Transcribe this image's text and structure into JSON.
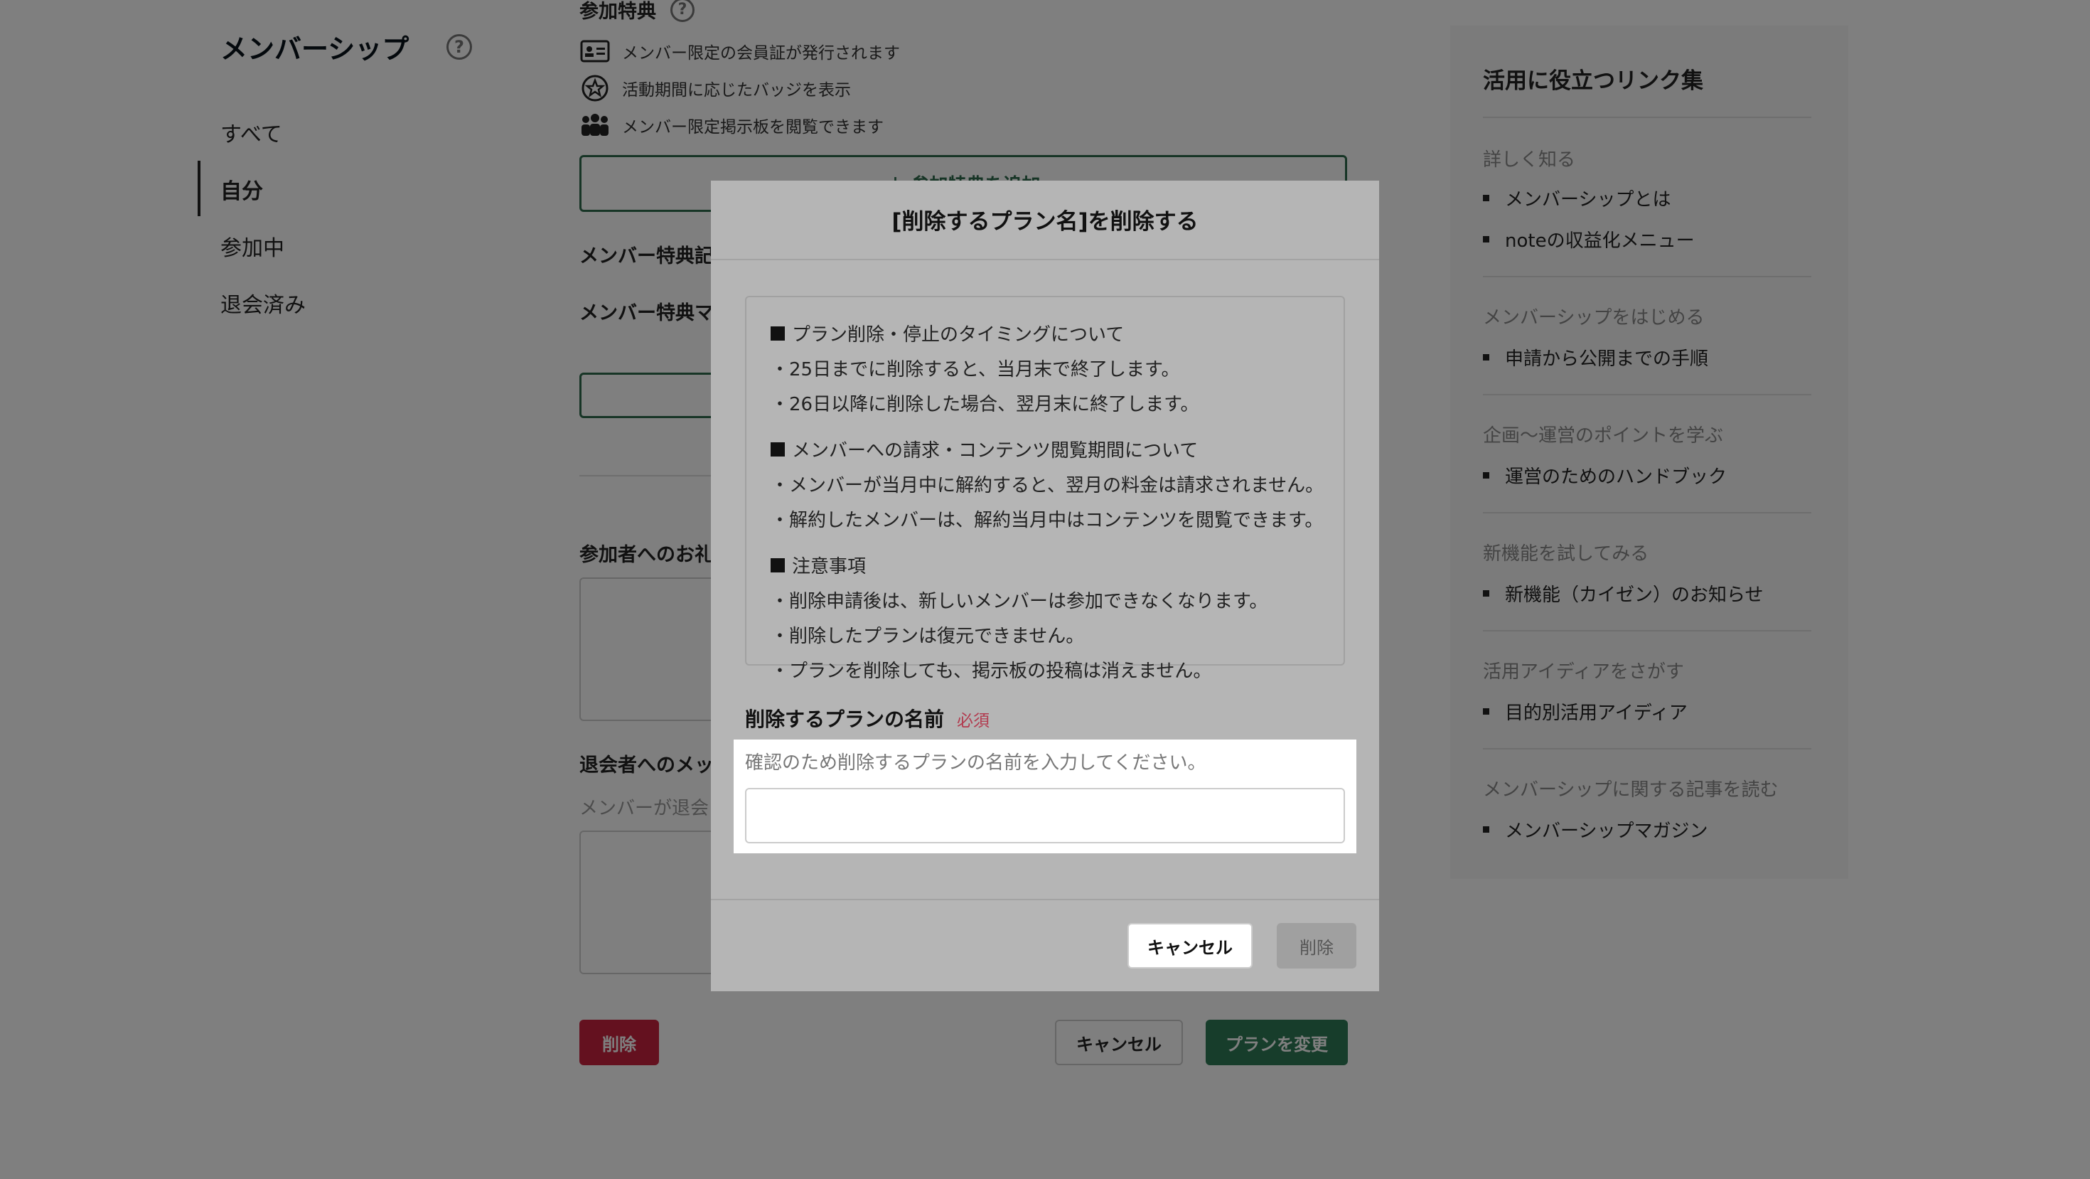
{
  "nav": {
    "title": "メンバーシップ",
    "items": [
      {
        "label": "すべて"
      },
      {
        "label": "自分"
      },
      {
        "label": "参加中"
      },
      {
        "label": "退会済み"
      }
    ]
  },
  "form": {
    "benefits_heading": "参加特典",
    "benefits": [
      {
        "icon": "id-card-icon",
        "label": "メンバー限定の会員証が発行されます"
      },
      {
        "icon": "badge-star-icon",
        "label": "活動期間に応じたバッジを表示"
      },
      {
        "icon": "people-icon",
        "label": "メンバー限定掲示板を閲覧できます"
      }
    ],
    "add_benefit_label": "＋ 参加特典を追加",
    "article_heading": "メンバー特典記",
    "magazine_heading": "メンバー特典マ",
    "thanks_heading": "参加者へのお礼",
    "leave_heading": "退会者へのメッ",
    "leave_sub": "メンバーが退会",
    "delete_label": "削除",
    "cancel_label": "キャンセル",
    "change_label": "プランを変更"
  },
  "sidebar": {
    "title": "活用に役立つリンク集",
    "sections": [
      {
        "heading": "詳しく知る",
        "links": [
          "メンバーシップとは",
          "noteの収益化メニュー"
        ]
      },
      {
        "heading": "メンバーシップをはじめる",
        "links": [
          "申請から公開までの手順"
        ]
      },
      {
        "heading": "企画〜運営のポイントを学ぶ",
        "links": [
          "運営のためのハンドブック"
        ]
      },
      {
        "heading": "新機能を試してみる",
        "links": [
          "新機能（カイゼン）のお知らせ"
        ]
      },
      {
        "heading": "活用アイディアをさがす",
        "links": [
          "目的別活用アイディア"
        ]
      },
      {
        "heading": "メンバーシップに関する記事を読む",
        "links": [
          "メンバーシップマガジン"
        ]
      }
    ]
  },
  "modal": {
    "title": "[削除するプラン名]を削除する",
    "notice": [
      {
        "heading": "プラン削除・停止のタイミングについて",
        "lines": [
          "・25日までに削除すると、当月末で終了します。",
          "・26日以降に削除した場合、翌月末に終了します。"
        ]
      },
      {
        "heading": "メンバーへの請求・コンテンツ閲覧期間について",
        "lines": [
          "・メンバーが当月中に解約すると、翌月の料金は請求されません。",
          "・解約したメンバーは、解約当月中はコンテンツを閲覧できます。"
        ]
      },
      {
        "heading": "注意事項",
        "lines": [
          "・削除申請後は、新しいメンバーは参加できなくなります。",
          "・削除したプランは復元できません。",
          "・プランを削除しても、掲示板の投稿は消えません。"
        ]
      }
    ],
    "field_label": "削除するプランの名前",
    "required_label": "必須",
    "field_hint": "確認のため削除するプランの名前を入力してください。",
    "field_value": "",
    "cancel_label": "キャンセル",
    "delete_label": "削除"
  },
  "colors": {
    "accent_green": "#2e7b57",
    "danger_red": "#c8233f",
    "required_red": "#b23a4e"
  }
}
